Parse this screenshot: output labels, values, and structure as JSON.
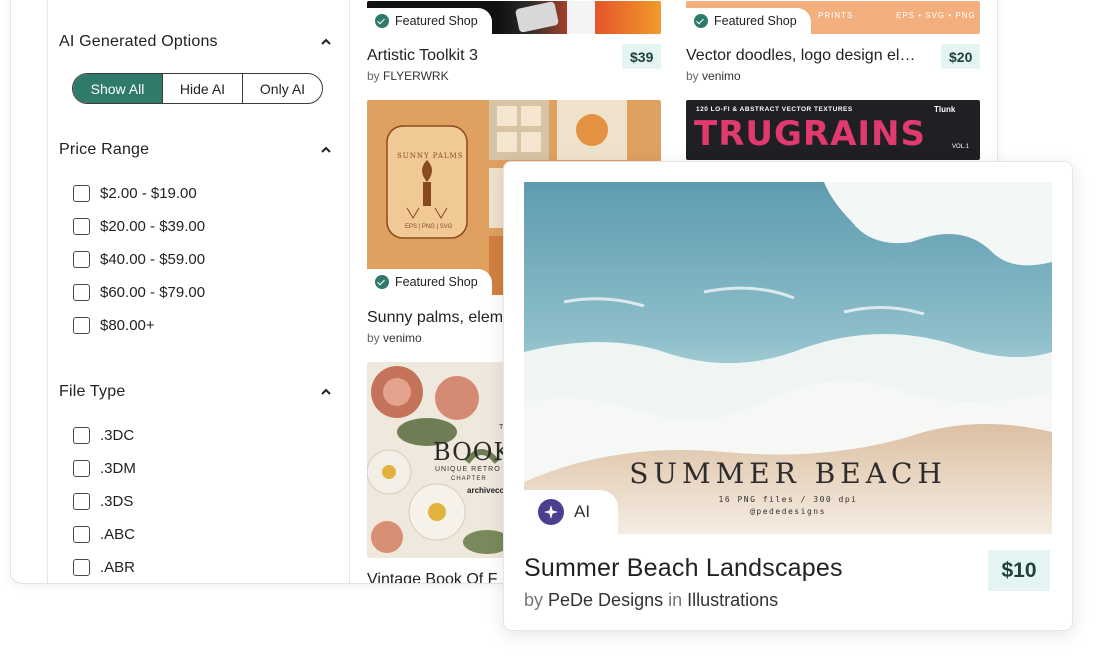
{
  "filters": {
    "ai": {
      "title": "AI Generated Options",
      "options": [
        "Show All",
        "Hide AI",
        "Only AI"
      ],
      "selected": "Show All"
    },
    "price": {
      "title": "Price Range",
      "options": [
        "$2.00 - $19.00",
        "$20.00 - $39.00",
        "$40.00 - $59.00",
        "$60.00 - $79.00",
        "$80.00+"
      ]
    },
    "file_type": {
      "title": "File Type",
      "options": [
        ".3DC",
        ".3DM",
        ".3DS",
        ".ABC",
        ".ABR"
      ]
    }
  },
  "products": [
    {
      "badge": "Featured Shop",
      "title": "Artistic Toolkit 3",
      "by_prefix": "by",
      "author": "FLYERWRK",
      "price": "$39"
    },
    {
      "badge": "Featured Shop",
      "title": "Vector doodles, logo design el…",
      "by_prefix": "by",
      "author": "venimo",
      "price": "$20"
    },
    {
      "badge": "Featured Shop",
      "title": "Sunny palms, elem",
      "by_prefix": "by",
      "author": "venimo",
      "art_text": "SUNNY PALMS",
      "art_sub": "EPS | PNG | SVG"
    },
    {
      "art_text": "TRUGRAINS",
      "art_top": "120 LO-FI & ABSTRACT VECTOR TEXTURES",
      "art_vol": "VOL.1",
      "brand": "Tlunk"
    },
    {
      "title": "Vintage Book Of F",
      "art_text": "BOOK OF",
      "art_sub": "UNIQUE RETRO",
      "art_sub2": "CHAPTER",
      "art_brand": "archivecor",
      "art_the": "THE"
    },
    {
      "small_text": "PRINTS",
      "formats": "EPS • SVG • PNG"
    }
  ],
  "featured_item": {
    "badge": "AI",
    "title": "Summer Beach Landscapes",
    "by_prefix": "by",
    "author": "PeDe Designs",
    "in_word": "in",
    "category": "Illustrations",
    "price": "$10",
    "art_title": "SUMMER BEACH",
    "art_sub": "16 PNG files / 300 dpi",
    "art_handle": "@pededesigns"
  },
  "colors": {
    "accent": "#2f7a6b",
    "price_chip_bg": "#e3f4f2",
    "ai_icon": "#4a3f8f"
  },
  "icons": {
    "caret": "chevron-up-icon",
    "featured": "check-badge-icon",
    "ai": "sparkle-icon"
  }
}
